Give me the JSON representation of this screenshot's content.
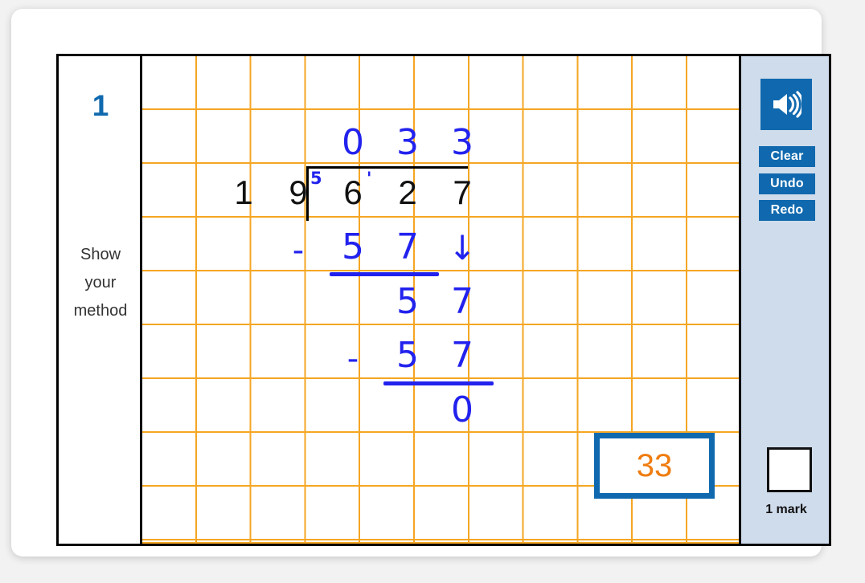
{
  "question": {
    "number": "1",
    "instruction_lines": [
      "Show",
      "your",
      "method"
    ]
  },
  "worksheet": {
    "divisor": [
      "1",
      "9"
    ],
    "dividend": [
      "6",
      "2",
      "7"
    ],
    "quotient": [
      "0",
      "3",
      "3"
    ],
    "carry_marks": [
      {
        "label": "5",
        "over": "6"
      },
      {
        "label": "'",
        "over": "2"
      }
    ],
    "work_rows": [
      {
        "minus": "-",
        "digits": [
          "5",
          "7"
        ],
        "bring_down": "↓"
      },
      {
        "minus": "",
        "digits": [
          "5",
          "7"
        ],
        "bring_down": ""
      },
      {
        "minus": "-",
        "digits": [
          "5",
          "7"
        ],
        "bring_down": ""
      },
      {
        "minus": "",
        "digits": [
          "0"
        ],
        "bring_down": ""
      }
    ]
  },
  "answer": {
    "value": "33"
  },
  "sidebar": {
    "audio_icon": "speaker-icon",
    "buttons": [
      {
        "id": "clear",
        "label": "Clear"
      },
      {
        "id": "undo",
        "label": "Undo"
      },
      {
        "id": "redo",
        "label": "Redo"
      }
    ],
    "mark_label": "1 mark",
    "mark_value": ""
  },
  "colors": {
    "ink_blue": "#2222EE",
    "ui_blue": "#1069AE",
    "grid_orange": "#F5A623",
    "answer_orange": "#EF7C0F",
    "sidebar_bg": "#CFDCEC",
    "print_black": "#111111"
  }
}
